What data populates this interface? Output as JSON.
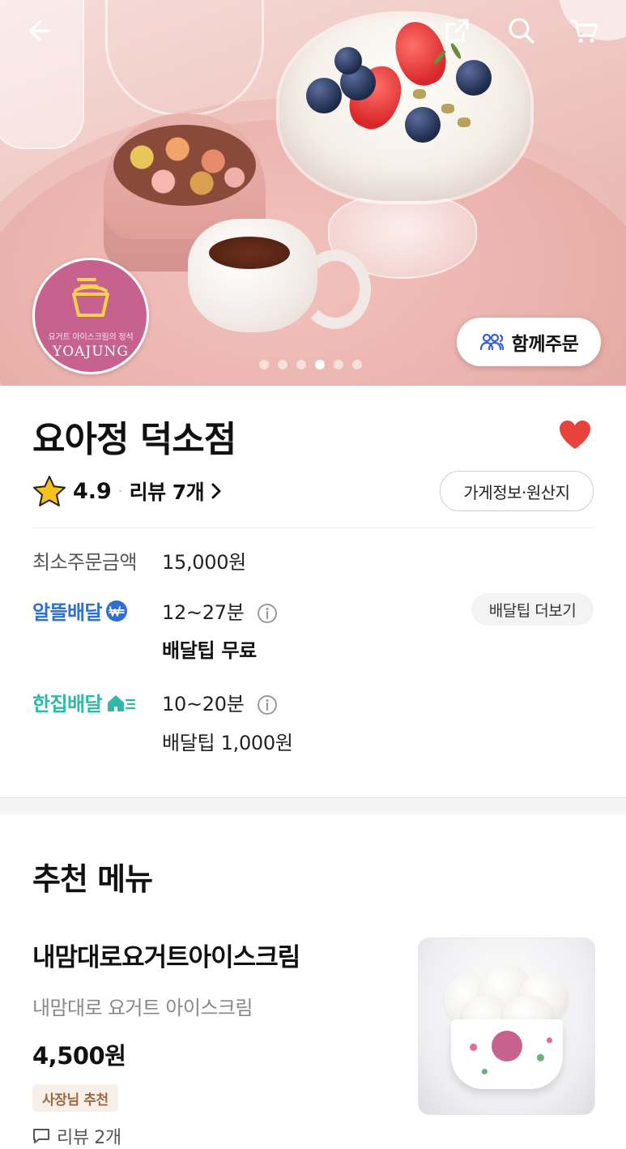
{
  "header": {
    "icons": [
      "back-arrow-icon",
      "share-icon",
      "search-icon",
      "cart-icon"
    ]
  },
  "hero": {
    "logo": {
      "tagline": "요거트 아이스크림의 정석",
      "wordmark": "YOAJUNG"
    },
    "together_order_label": "함께주문",
    "carousel": {
      "count": 6,
      "active_index": 3
    }
  },
  "store": {
    "name": "요아정 덕소점",
    "favorited": true,
    "rating": "4.9",
    "reviews_label": "리뷰 7개",
    "info_button": "가게정보·원산지"
  },
  "delivery": {
    "min_order_label": "최소주문금액",
    "min_order_value": "15,000원",
    "alddeul": {
      "label": "알뜰배달",
      "time": "12~27분",
      "tip": "배달팁 무료",
      "tip_more_button": "배달팁 더보기",
      "color": "#2d6fd6"
    },
    "hanjip": {
      "label": "한집배달",
      "time": "10~20분",
      "tip": "배달팁 1,000원",
      "color": "#2fb9a8"
    }
  },
  "recommended": {
    "title": "추천 메뉴",
    "items": [
      {
        "name": "내맘대로요거트아이스크림",
        "description": "내맘대로 요거트 아이스크림",
        "price": "4,500원",
        "badge": "사장님 추천",
        "reviews": "리뷰 2개"
      }
    ]
  },
  "colors": {
    "heart": "#e8433a",
    "logo_pink": "#c7618e",
    "star": "#f7c21a"
  }
}
